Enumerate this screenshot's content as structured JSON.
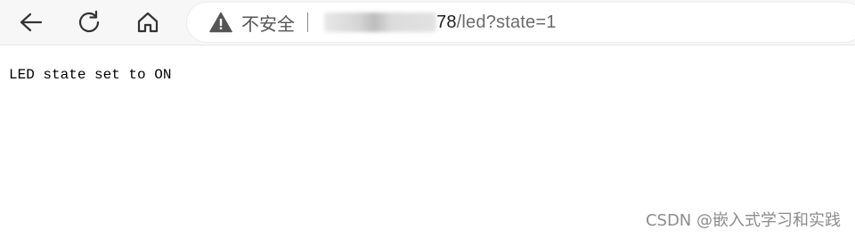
{
  "toolbar": {
    "back_icon": "back-arrow-icon",
    "reload_icon": "reload-icon",
    "home_icon": "home-icon"
  },
  "address_bar": {
    "security_icon": "warning-triangle-icon",
    "security_label": "不安全",
    "url_host_suffix": "78",
    "url_path": "/led?state=1"
  },
  "page": {
    "message": "LED state set to ON"
  },
  "watermark": {
    "text": "CSDN @嵌入式学习和实践"
  },
  "colors": {
    "toolbar_bg": "#f7f7f7",
    "icon": "#333333",
    "warning_icon": "#555555",
    "url_host": "#202020",
    "url_path": "#6b6b6b"
  }
}
